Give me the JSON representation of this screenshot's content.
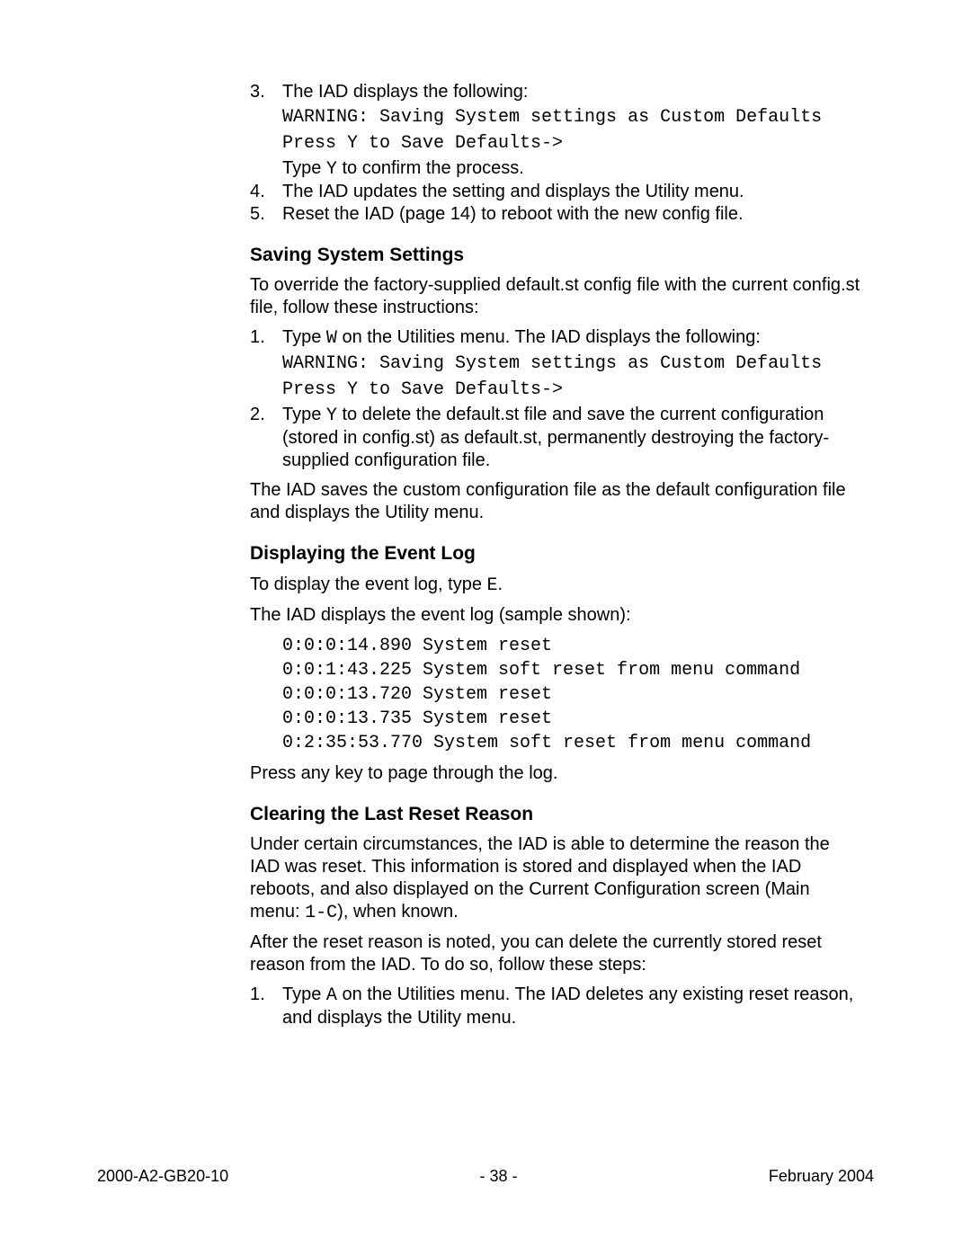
{
  "section1": {
    "item3": {
      "num": "3.",
      "lead": "The IAD displays the following:",
      "code1": "WARNING: Saving System settings as Custom Defaults",
      "code2": "Press Y to Save Defaults->",
      "type_prefix": "Type ",
      "type_key": "Y",
      "type_suffix": " to confirm the process."
    },
    "item4": {
      "num": "4.",
      "text": "The IAD updates the setting and displays the Utility menu."
    },
    "item5": {
      "num": "5.",
      "text": "Reset the IAD (page 14) to reboot with the new config file."
    }
  },
  "saving": {
    "heading": "Saving System Settings",
    "intro": "To override the factory-supplied default.st config file with the current config.st file, follow these instructions:",
    "item1": {
      "num": "1.",
      "lead_prefix": "Type ",
      "lead_key": "W",
      "lead_suffix": " on the Utilities menu. The IAD displays the following:",
      "code1": "WARNING: Saving System settings as Custom Defaults",
      "code2": "Press Y to Save Defaults->"
    },
    "item2": {
      "num": "2.",
      "prefix": "Type ",
      "key": "Y",
      "suffix": " to delete the default.st file and save the current configuration (stored in config.st) as default.st, permanently destroying the factory-supplied configuration file."
    },
    "outro": "The IAD saves the custom configuration file as the default configuration file and displays the Utility menu."
  },
  "eventlog": {
    "heading": "Displaying the Event Log",
    "intro_prefix": "To display the event log, type ",
    "intro_key": "E",
    "intro_suffix": ".",
    "line2": "The IAD displays the event log (sample shown):",
    "log": "0:0:0:14.890 System reset\n0:0:1:43.225 System soft reset from menu command\n0:0:0:13.720 System reset\n0:0:0:13.735 System reset\n0:2:35:53.770 System soft reset from menu command",
    "press": "Press any key to page through the log."
  },
  "clearing": {
    "heading": "Clearing the Last Reset Reason",
    "p1_prefix": "Under certain circumstances, the IAD is able to determine the reason the IAD was reset. This information is stored and displayed when the IAD reboots, and also displayed on the Current Configuration screen (Main menu: ",
    "p1_key": "1-C",
    "p1_suffix": "), when known.",
    "p2": "After the reset reason is noted, you can delete the currently stored reset reason from the IAD. To do so, follow these steps:",
    "item1": {
      "num": "1.",
      "prefix": "Type ",
      "key": "A",
      "suffix": " on the Utilities menu. The IAD deletes any existing reset reason, and displays the Utility menu."
    }
  },
  "footer": {
    "left": "2000-A2-GB20-10",
    "center": "- 38 -",
    "right": "February 2004"
  }
}
